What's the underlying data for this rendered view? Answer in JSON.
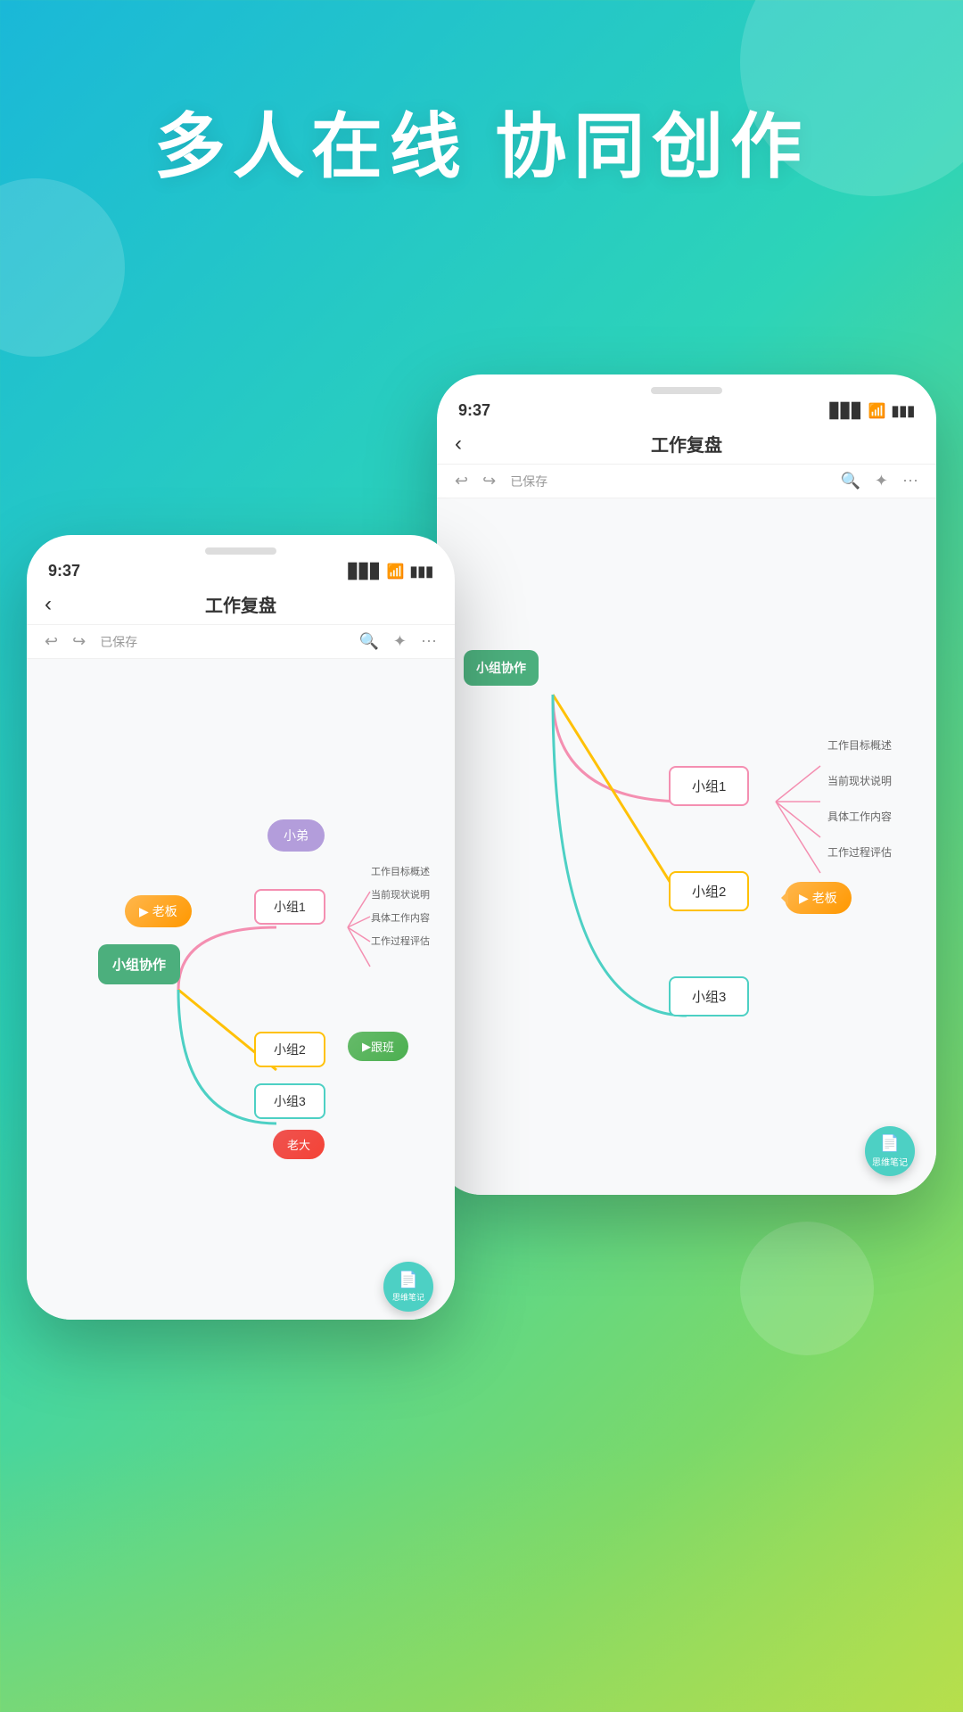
{
  "hero": {
    "title": "多人在线 协同创作"
  },
  "phone_back": {
    "time": "9:37",
    "title": "工作复盘",
    "saved_label": "已保存",
    "nodes": {
      "center_label": "小组协作",
      "group1": "小组1",
      "group2": "小组2",
      "group3": "小组3",
      "user_boss": "老板",
      "sub_labels": [
        "工作目标概述",
        "当前现状说明",
        "具体工作内容",
        "工作过程评估"
      ],
      "fab_label": "思维笔记"
    }
  },
  "phone_front": {
    "time": "9:37",
    "title": "工作复盘",
    "saved_label": "已保存",
    "nodes": {
      "center_label": "小组协作",
      "group1": "小组1",
      "group2": "小组2",
      "group3": "小组3",
      "user_boss": "老板",
      "user_xiaoди": "小弟",
      "user_laoban": "老板",
      "user_gen": "跟班",
      "user_laoda": "老大",
      "sub_labels": [
        "工作目标概述",
        "当前现状说明",
        "具体工作内容",
        "工作过程评估"
      ],
      "fab_label": "思维笔记"
    }
  },
  "icons": {
    "back": "‹",
    "undo": "↩",
    "redo": "↪",
    "search": "🔍",
    "share": "✦",
    "more": "⋯",
    "signal": "▊▊▊",
    "wifi": "WiFi",
    "battery": "▮▮▮",
    "note": "📄"
  }
}
